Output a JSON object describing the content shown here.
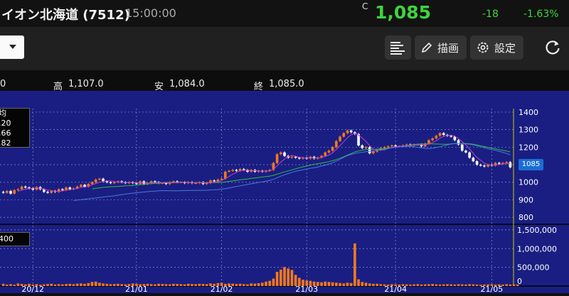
{
  "header": {
    "title": "イオン北海道 (7512)",
    "time": "15:00:00",
    "price_flag": "C",
    "last_price": "1,085",
    "change": "-18",
    "change_pct": "-1.63%"
  },
  "toolbar": {
    "draw_label": "描画",
    "settings_label": "設定"
  },
  "ohlc": {
    "open_value": "0",
    "high_label": "高",
    "high_value": "1,107.0",
    "low_label": "安",
    "low_value": "1,084.0",
    "close_label": "終",
    "close_value": "1,085.0"
  },
  "legend": {
    "ma_title": "均",
    "ma_values": [
      ".20",
      ".66",
      ".82"
    ],
    "volume_value": "400"
  },
  "last_price_label": "1085",
  "chart_data": {
    "type": "candlestick",
    "price_axis": [
      "1400",
      "1300",
      "1200",
      "1100",
      "1000",
      "900",
      "800"
    ],
    "price_ylim": [
      760,
      1420
    ],
    "volume_axis": [
      "1,500,000",
      "1,000,000",
      "500,000",
      "0"
    ],
    "volume_ylim": [
      0,
      1650000
    ],
    "x_ticks": [
      "20/12",
      "21/01",
      "21/02",
      "21/03",
      "21/04",
      "21/05"
    ],
    "x_tick_index": [
      8,
      36,
      59,
      82,
      106,
      132
    ],
    "close": [
      940,
      950,
      935,
      955,
      960,
      975,
      970,
      965,
      958,
      972,
      960,
      945,
      940,
      950,
      945,
      960,
      955,
      970,
      960,
      965,
      975,
      985,
      975,
      990,
      1000,
      1015,
      1020,
      1005,
      1000,
      995,
      1000,
      1005,
      1000,
      995,
      1000,
      995,
      990,
      1005,
      990,
      995,
      1005,
      1000,
      995,
      995,
      990,
      1000,
      1005,
      1000,
      1000,
      995,
      1000,
      995,
      995,
      1000,
      990,
      995,
      1010,
      1005,
      1015,
      1020,
      1060,
      1065,
      1070,
      1065,
      1075,
      1070,
      1060,
      1070,
      1060,
      1065,
      1060,
      1065,
      1070,
      1110,
      1160,
      1170,
      1150,
      1140,
      1145,
      1140,
      1135,
      1140,
      1135,
      1145,
      1135,
      1140,
      1150,
      1170,
      1180,
      1200,
      1235,
      1260,
      1280,
      1295,
      1285,
      1275,
      1210,
      1195,
      1200,
      1165,
      1175,
      1185,
      1195,
      1200,
      1205,
      1210,
      1205,
      1205,
      1210,
      1215,
      1210,
      1215,
      1215,
      1205,
      1220,
      1240,
      1250,
      1265,
      1280,
      1270,
      1265,
      1260,
      1240,
      1215,
      1180,
      1170,
      1140,
      1120,
      1100,
      1095,
      1090,
      1100,
      1095,
      1110,
      1105,
      1110,
      1115,
      1085
    ],
    "volume": [
      60000,
      40000,
      50000,
      35000,
      70000,
      55000,
      45000,
      60000,
      40000,
      50000,
      35000,
      45000,
      55000,
      60000,
      40000,
      50000,
      45000,
      55000,
      60000,
      50000,
      65000,
      70000,
      60000,
      80000,
      110000,
      120000,
      90000,
      70000,
      60000,
      50000,
      55000,
      60000,
      50000,
      45000,
      55000,
      70000,
      60000,
      50000,
      55000,
      60000,
      50000,
      45000,
      60000,
      55000,
      50000,
      45000,
      60000,
      55000,
      50000,
      45000,
      60000,
      55000,
      50000,
      60000,
      55000,
      50000,
      70000,
      60000,
      80000,
      90000,
      60000,
      70000,
      65000,
      55000,
      60000,
      50000,
      45000,
      70000,
      65000,
      75000,
      90000,
      120000,
      140000,
      200000,
      380000,
      440000,
      510000,
      470000,
      430000,
      300000,
      220000,
      170000,
      150000,
      140000,
      120000,
      110000,
      100000,
      120000,
      110000,
      100000,
      90000,
      80000,
      70000,
      90000,
      80000,
      1140000,
      180000,
      110000,
      90000,
      70000,
      60000,
      60000,
      50000,
      45000,
      40000,
      50000,
      45000,
      40000,
      50000,
      45000,
      40000,
      45000,
      50000,
      40000,
      45000,
      50000,
      55000,
      45000,
      40000,
      45000,
      50000,
      45000,
      40000,
      50000,
      45000,
      40000,
      50000,
      45000,
      40000,
      35000,
      40000,
      45000,
      50000,
      40000,
      45000,
      40000,
      50000,
      40000,
      45000,
      40000
    ]
  },
  "colors": {
    "up": "#f4781e",
    "down": "#ffffff",
    "ma_short": "#c040c0",
    "ma_mid": "#28c040",
    "ma_long": "#4a78e0",
    "volume": "#f4781e",
    "panel_bg": "#1a1e82",
    "price_up": "#3ed43e"
  }
}
